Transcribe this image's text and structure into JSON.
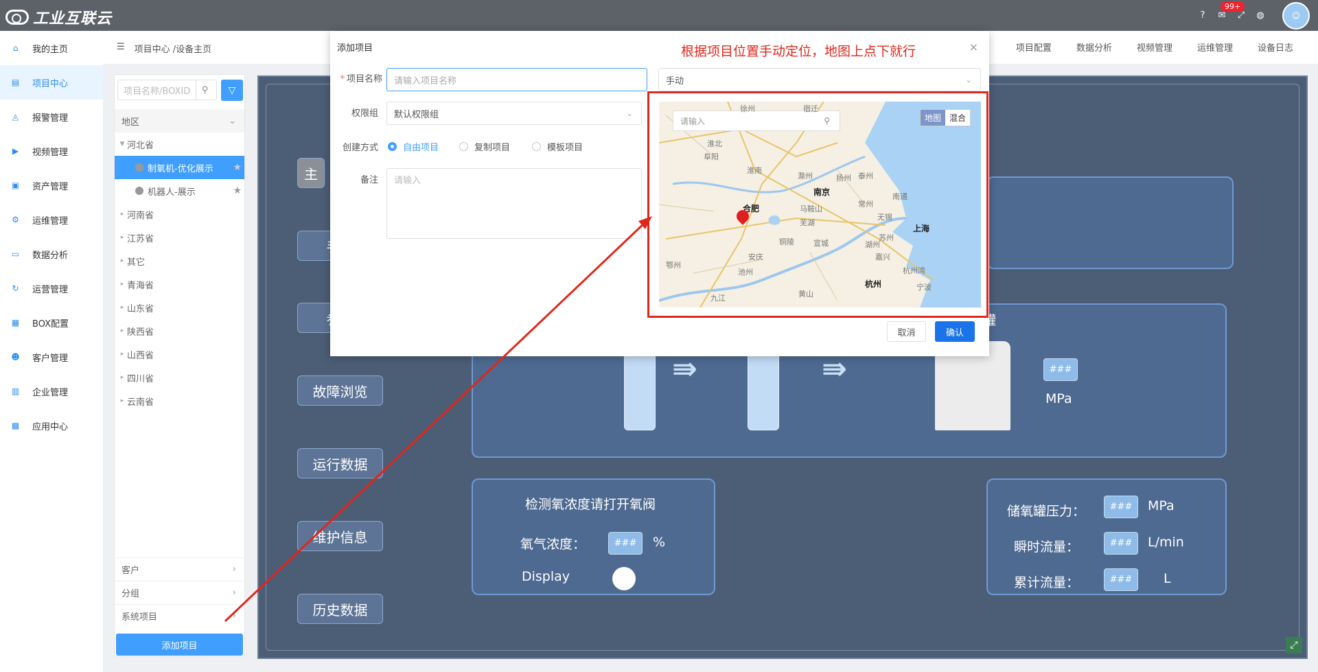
{
  "app": {
    "logo_text": "工业互联云",
    "notif_badge": "99+",
    "avatar_alt": "用户"
  },
  "sidebar": {
    "items": [
      {
        "label": "我的主页",
        "icon": "home-icon"
      },
      {
        "label": "项目中心",
        "icon": "project-icon",
        "active": true
      },
      {
        "label": "报警管理",
        "icon": "bell-icon"
      },
      {
        "label": "视频管理",
        "icon": "video-icon"
      },
      {
        "label": "资产管理",
        "icon": "asset-icon"
      },
      {
        "label": "运维管理",
        "icon": "gear-icon"
      },
      {
        "label": "数据分析",
        "icon": "monitor-icon"
      },
      {
        "label": "运营管理",
        "icon": "cycle-icon"
      },
      {
        "label": "BOX配置",
        "icon": "box-icon"
      },
      {
        "label": "客户管理",
        "icon": "users-icon"
      },
      {
        "label": "企业管理",
        "icon": "building-icon"
      },
      {
        "label": "应用中心",
        "icon": "grid-icon"
      }
    ]
  },
  "header": {
    "breadcrumb": "项目中心 /设备主页",
    "tabs": [
      "项目配置",
      "数据分析",
      "视频管理",
      "运维管理",
      "设备日志"
    ]
  },
  "projects": {
    "search_placeholder": "项目名称/BOXID",
    "region_label": "地区",
    "tree": [
      {
        "label": "河北省",
        "expanded": true
      },
      {
        "label": "制氧机-优化展示",
        "child": true,
        "selected": true
      },
      {
        "label": "机器人-展示",
        "child": true
      },
      {
        "label": "河南省"
      },
      {
        "label": "江苏省"
      },
      {
        "label": "其它"
      },
      {
        "label": "青海省"
      },
      {
        "label": "山东省"
      },
      {
        "label": "陕西省"
      },
      {
        "label": "山西省"
      },
      {
        "label": "四川省"
      },
      {
        "label": "云南省"
      }
    ],
    "customer_label": "客户",
    "group_label": "分组",
    "system_label": "系统项目",
    "add_button": "添加项目"
  },
  "dashboard": {
    "left_buttons": [
      "主",
      "手动",
      "参数",
      "故障浏览",
      "运行数据",
      "维护信息",
      "历史数据"
    ],
    "tank_label": "罐",
    "pressure_unit": "MPa",
    "hash": "###",
    "oxygen_title": "检测氧浓度请打开氧阀",
    "oxygen_label": "氧气浓度：",
    "oxygen_unit": "%",
    "display_label": "Display",
    "right_rows": [
      {
        "label": "储氧罐压力：",
        "unit": "MPa"
      },
      {
        "label": "瞬时流量：",
        "unit": "L/min"
      },
      {
        "label": "累计流量：",
        "unit": "L"
      }
    ]
  },
  "modal": {
    "title": "添加项目",
    "name_label": "项目名称",
    "name_placeholder": "请输入项目名称",
    "locate_mode": "手动",
    "perm_label": "权限组",
    "perm_value": "默认权限组",
    "create_label": "创建方式",
    "create_options": [
      "自由项目",
      "复制项目",
      "模板项目"
    ],
    "create_selected": "自由项目",
    "note_label": "备注",
    "note_placeholder": "请输入",
    "cancel": "取消",
    "confirm": "确认"
  },
  "map": {
    "search_placeholder": "请输入",
    "type_options": [
      "地图",
      "混合"
    ],
    "cities": [
      "南京",
      "合肥",
      "上海",
      "杭州"
    ],
    "towns": [
      "徐州",
      "淮北",
      "宿迁",
      "阜阳",
      "淮南",
      "滁州",
      "扬州",
      "泰州",
      "南通",
      "马鞍山",
      "常州",
      "无锡",
      "芜湖",
      "苏州",
      "铜陵",
      "宣城",
      "湖州",
      "嘉兴",
      "安庆",
      "池州",
      "杭州湾",
      "宁波",
      "黄山",
      "九江",
      "鄂州"
    ]
  },
  "annotation": "根据项目位置手动定位，地图上点下就行"
}
